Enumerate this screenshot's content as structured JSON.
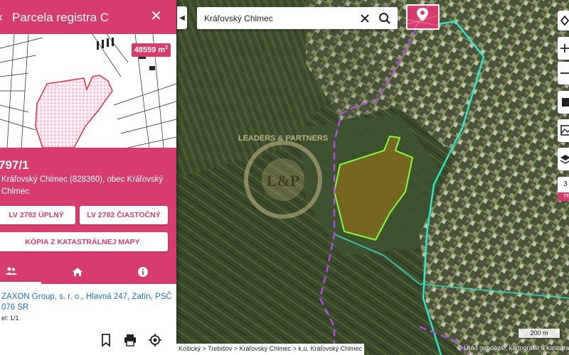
{
  "panel": {
    "back_icon": "chevron-left-icon",
    "title": "Parcela registra C",
    "close_icon": "close-icon",
    "area": "48559 m",
    "area_unit_sup": "2",
    "parcel_number": "797/1",
    "location": "Kráľovský Chlmec (828360), obec Kráľovský Chlmec",
    "buttons": {
      "lv_full": "LV 2782 ÚPLNÝ",
      "lv_partial": "LV 2782 ČIASTOČNÝ",
      "copy_map": "KÓPIA Z KATASTRÁLNEJ MAPY"
    },
    "tabs": [
      "owners-icon",
      "home-icon",
      "info-icon"
    ],
    "owner": "ZAXON Group, s. r. o., Hlavná 247, Zatín, PSČ 076 SR",
    "share": "el: 1/1",
    "bottom_icons": [
      "bookmark-icon",
      "print-icon",
      "locate-icon"
    ],
    "accent_color": "#d63d6e"
  },
  "search": {
    "value": "Kráľovský Chlmec",
    "clear_icon": "close-icon",
    "search_icon": "search-icon"
  },
  "map": {
    "pin_icon": "map-pin-icon",
    "zoom_level": "3",
    "zoom_badge": "TE",
    "scale": "200 m",
    "breadcrumb": "Košický > Trebišov > Kráľovský Chlmec > k.ú. Kráľovský Chlmec",
    "attribution": "© Úrad geodézie, kartografie a katastra",
    "watermark": "LEADERS & PARTNERS",
    "watermark_logo": "L&P",
    "parcel_outline_color": "#7cff3a",
    "boundary_color": "#2ee6c8",
    "admin_line_color": "#b04ae0"
  }
}
